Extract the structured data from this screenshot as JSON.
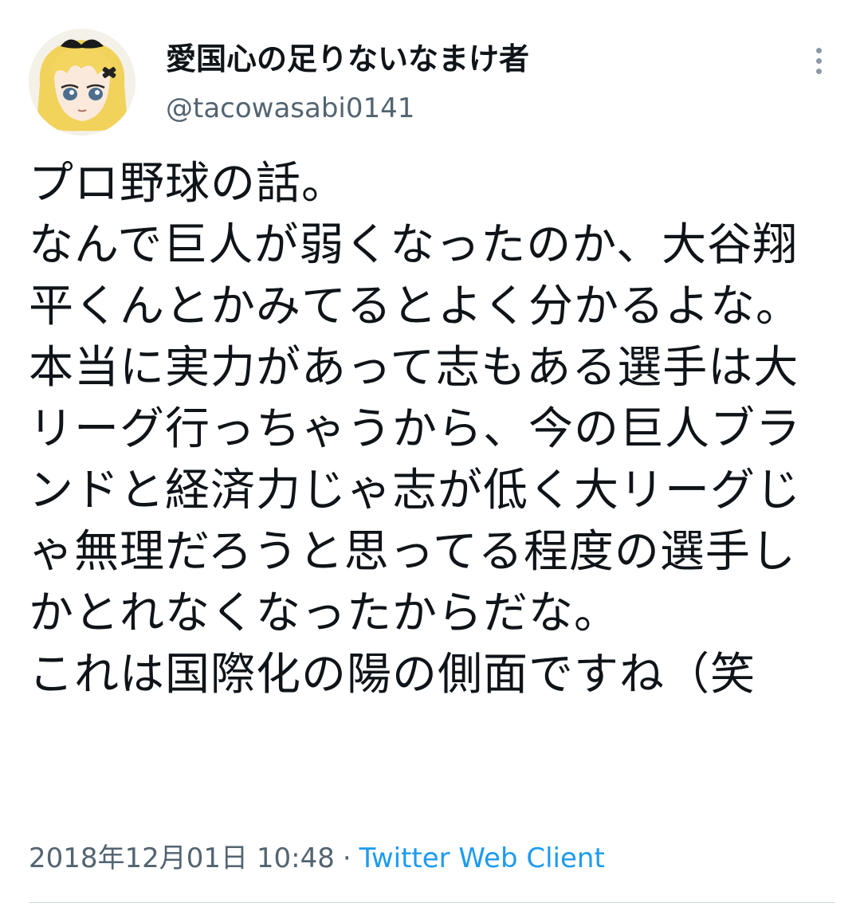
{
  "author": {
    "display_name": "愛国心の足りないなまけ者",
    "handle": "@tacowasabi0141"
  },
  "tweet": {
    "text": "プロ野球の話。\nなんで巨人が弱くなったのか、大谷翔平くんとかみてるとよく分かるよな。\n本当に実力があって志もある選手は大リーグ行っちゃうから、今の巨人ブランドと経済力じゃ志が低く大リーグじゃ無理だろうと思ってる程度の選手しかとれなくなったからだな。\nこれは国際化の陽の側面ですね（笑"
  },
  "meta": {
    "timestamp": "2018年12月01日 10:48",
    "separator": "·",
    "client": "Twitter Web Client"
  },
  "icons": {
    "more": "more-vertical-icon",
    "avatar": "anime-girl-avatar"
  },
  "colors": {
    "text": "#0f1419",
    "secondary": "#536471",
    "link": "#1d9bf0"
  }
}
